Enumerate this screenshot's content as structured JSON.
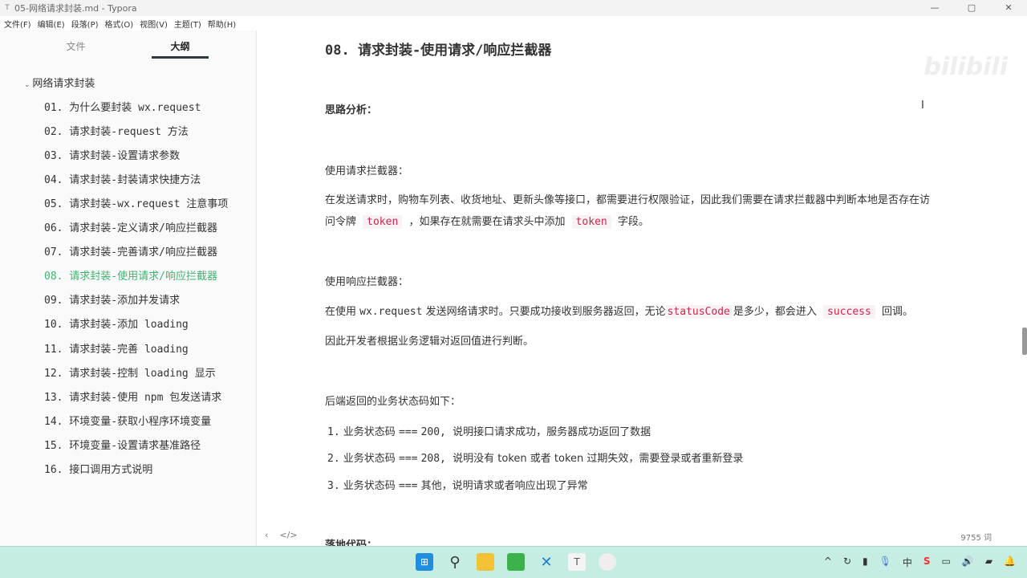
{
  "window": {
    "title": "05-网络请求封装.md - Typora",
    "app_icon": "T",
    "minimize": "—",
    "maximize": "▢",
    "close": "✕"
  },
  "menu": [
    "文件(F)",
    "编辑(E)",
    "段落(P)",
    "格式(O)",
    "视图(V)",
    "主题(T)",
    "帮助(H)"
  ],
  "sidebar": {
    "tabs": [
      "文件",
      "大纲"
    ],
    "active_tab": "大纲",
    "root": "网络请求封装",
    "items": [
      "01. 为什么要封装 wx.request",
      "02. 请求封装-request 方法",
      "03. 请求封装-设置请求参数",
      "04. 请求封装-封装请求快捷方法",
      "05. 请求封装-wx.request 注意事项",
      "06. 请求封装-定义请求/响应拦截器",
      "07. 请求封装-完善请求/响应拦截器",
      "08. 请求封装-使用请求/响应拦截器",
      "09. 请求封装-添加并发请求",
      "10. 请求封装-添加 loading",
      "11. 请求封装-完善 loading",
      "12. 请求封装-控制 loading 显示",
      "13. 请求封装-使用 npm 包发送请求",
      "14. 环境变量-获取小程序环境变量",
      "15. 环境变量-设置请求基准路径",
      "16. 接口调用方式说明"
    ],
    "active_index": 7
  },
  "doc": {
    "heading": "08. 请求封装-使用请求/响应拦截器",
    "analysis": "思路分析：",
    "req_title": "使用请求拦截器：",
    "req_p1": "在发送请求时，购物车列表、收货地址、更新头像等接口，都需要进行权限验证，因此我们需要在请求拦截器中判断本地是否存在访",
    "req_p2a": "问令牌",
    "req_code1": "token",
    "req_p2b": "，如果存在就需要在请求头中添加",
    "req_code2": "token",
    "req_p2c": "字段。",
    "res_title": "使用响应拦截器：",
    "res_p1a": "在使用",
    "res_code0": "wx.request",
    "res_p1b": "发送网络请求时。只要成功接收到服务器返回，无论",
    "res_code1": "statusCode",
    "res_p1c": "是多少，都会进入",
    "res_code2": "success",
    "res_p1d": "回调。",
    "res_p2": "因此开发者根据业务逻辑对返回值进行判断。",
    "codes_title": "后端返回的业务状态码如下：",
    "list": [
      {
        "num": "1.",
        "label": "业务状态码",
        "op": "===",
        "value": "200,",
        "desc": "说明接口请求成功，服务器成功返回了数据"
      },
      {
        "num": "2.",
        "label": "业务状态码",
        "op": "===",
        "value": "208,",
        "desc": "说明没有 token 或者 token 过期失效，需要登录或者重新登录"
      },
      {
        "num": "3.",
        "label": "业务状态码",
        "op": "===",
        "value": "",
        "desc": "其他，说明请求或者响应出现了异常"
      }
    ],
    "next_heading": "落地代码："
  },
  "footer": {
    "back": "‹",
    "source": "</>",
    "word_count": "9755 词"
  },
  "watermark": "bilibili"
}
